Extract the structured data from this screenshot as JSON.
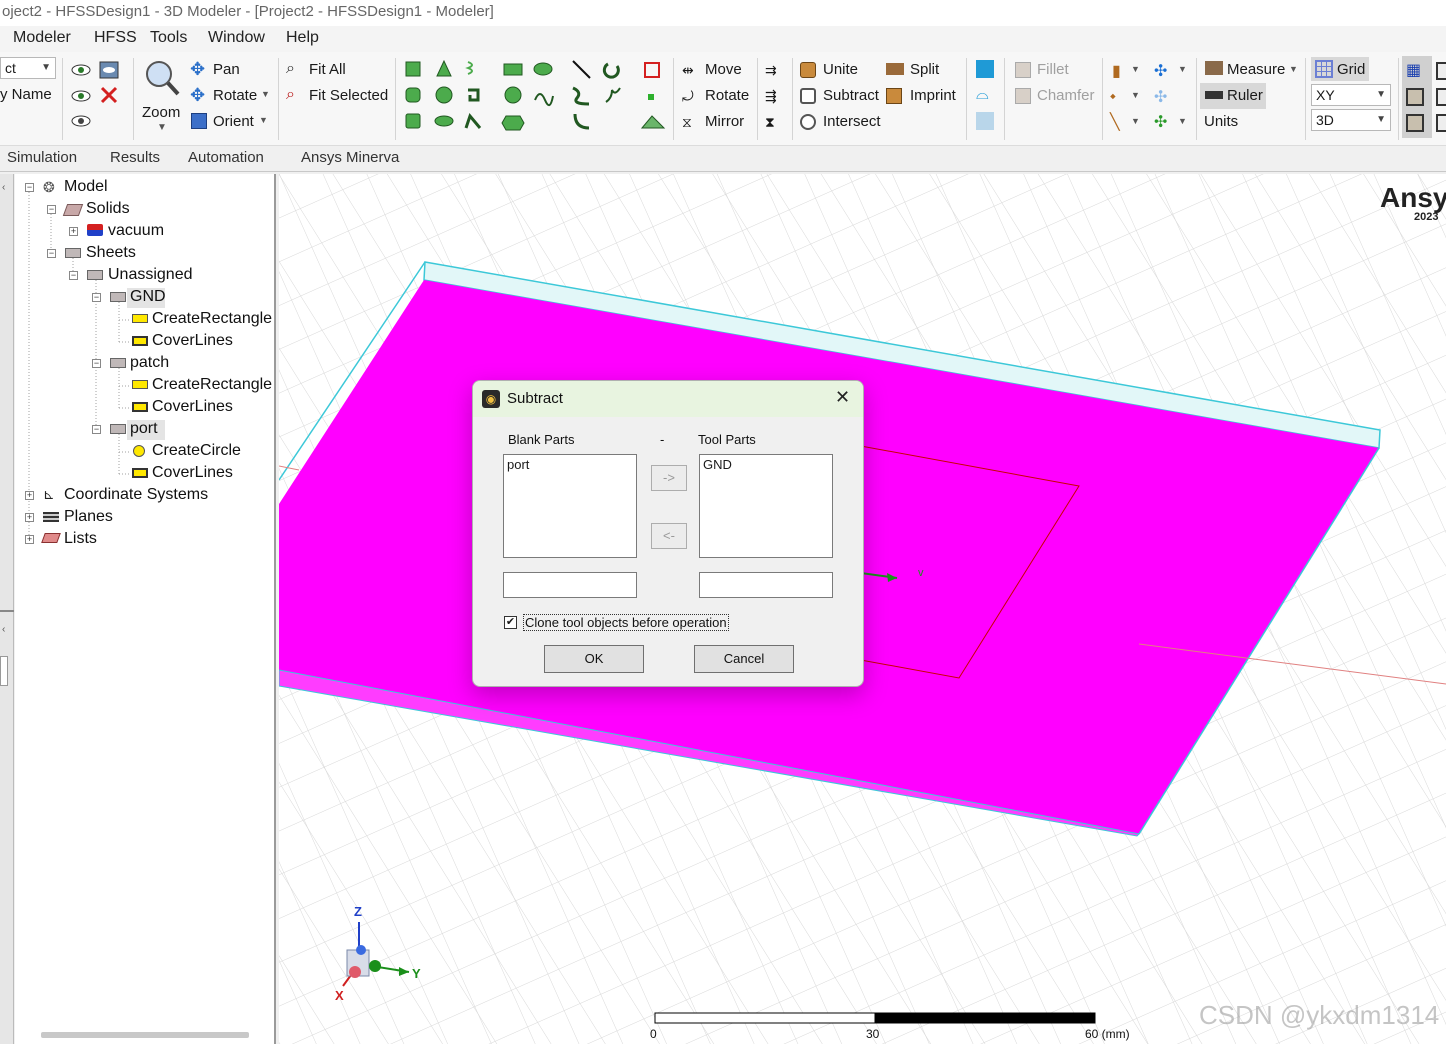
{
  "window": {
    "title": "oject2 - HFSSDesign1 - 3D Modeler - [Project2 - HFSSDesign1 - Modeler]"
  },
  "menu": [
    "Modeler",
    "HFSS",
    "Tools",
    "Window",
    "Help"
  ],
  "ribbon": {
    "combo_left": "ct",
    "name_label": "y Name",
    "zoom": "Zoom",
    "pan": "Pan",
    "rotate_view": "Rotate",
    "orient": "Orient",
    "fit_all": "Fit All",
    "fit_selected": "Fit Selected",
    "move": "Move",
    "rotate": "Rotate",
    "mirror": "Mirror",
    "unite": "Unite",
    "subtract": "Subtract",
    "intersect": "Intersect",
    "split": "Split",
    "imprint": "Imprint",
    "fillet": "Fillet",
    "chamfer": "Chamfer",
    "measure": "Measure",
    "ruler": "Ruler",
    "units": "Units",
    "grid": "Grid",
    "plane_value": "XY",
    "mode_value": "3D"
  },
  "tabs": [
    "Simulation",
    "Results",
    "Automation",
    "Ansys Minerva"
  ],
  "tree": {
    "model": "Model",
    "solids": "Solids",
    "vacuum": "vacuum",
    "sheets": "Sheets",
    "unassigned": "Unassigned",
    "gnd": "GND",
    "gnd_create": "CreateRectangle",
    "gnd_cover": "CoverLines",
    "patch": "patch",
    "patch_create": "CreateRectangle",
    "patch_cover": "CoverLines",
    "port": "port",
    "port_create": "CreateCircle",
    "port_cover": "CoverLines",
    "coord": "Coordinate Systems",
    "planes": "Planes",
    "lists": "Lists"
  },
  "viewport": {
    "brand": "Ansy",
    "brand_year": "2023",
    "axis_x": "X",
    "axis_y": "Y",
    "axis_z": "Z",
    "origin_axis_label": "v",
    "scale_0": "0",
    "scale_30": "30",
    "scale_60": "60 (mm)",
    "watermark": "CSDN @ykxdm1314",
    "colors": {
      "substrate": "#ff00ff",
      "box_edge": "#3cc8d8",
      "grid": "#dcdcdc"
    }
  },
  "dialog": {
    "title": "Subtract",
    "blank_label": "Blank Parts",
    "dash": "-",
    "tool_label": "Tool Parts",
    "blank_items": [
      "port"
    ],
    "tool_items": [
      "GND"
    ],
    "move_right": "->",
    "move_left": "<-",
    "clone_label": "Clone tool objects before operation",
    "clone_checked": true,
    "ok": "OK",
    "cancel": "Cancel",
    "close_icon": "close-icon"
  }
}
